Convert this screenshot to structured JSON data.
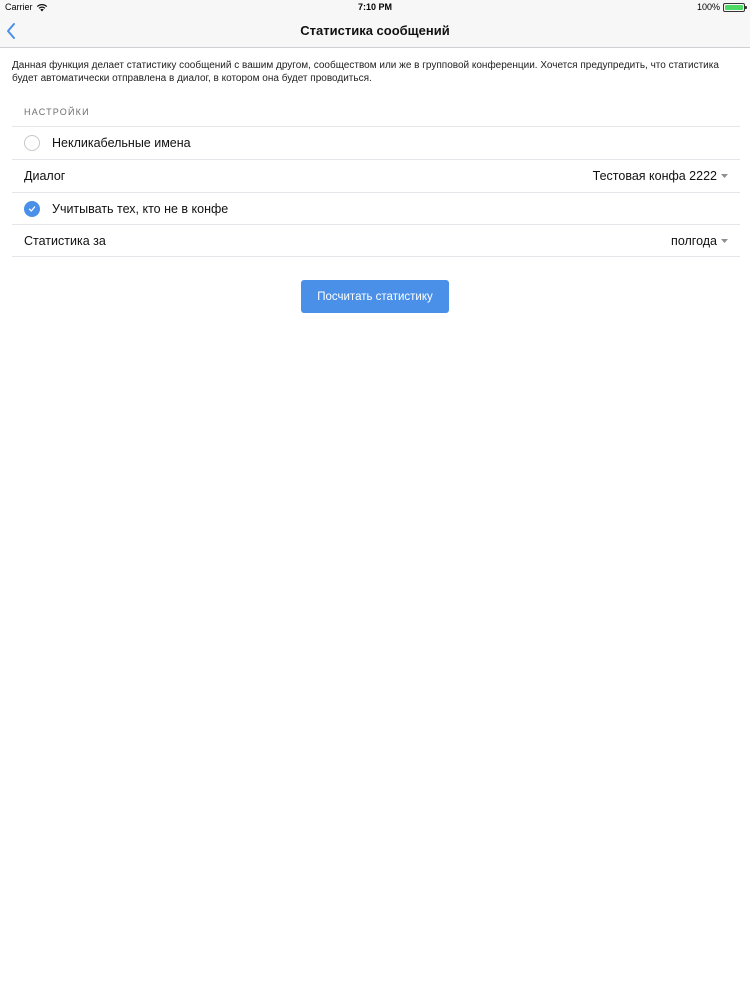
{
  "status_bar": {
    "carrier": "Carrier",
    "time": "7:10 PM",
    "battery": "100%",
    "wifi_icon": "wifi-icon",
    "battery_icon": "battery-icon"
  },
  "nav": {
    "title": "Статистика сообщений",
    "back_icon": "chevron-left-icon"
  },
  "description": "Данная функция делает статистику сообщений с вашим другом, сообществом или же в групповой конференции. Хочется предупредить, что статистика будет автоматически отправлена в диалог, в котором она будет проводиться.",
  "settings": {
    "header": "НАСТРОЙКИ",
    "unclickable_names": {
      "label": "Некликабельные имена",
      "checked": false
    },
    "dialog": {
      "label": "Диалог",
      "value": "Тестовая конфа 2222"
    },
    "include_not_in_conf": {
      "label": "Учитывать тех, кто не в конфе",
      "checked": true
    },
    "period": {
      "label": "Статистика за",
      "value": "полгода"
    }
  },
  "submit_button": "Посчитать статистику",
  "colors": {
    "accent": "#4a90e8",
    "separator": "#e6e6ea",
    "bar_background": "#f7f7f7"
  }
}
